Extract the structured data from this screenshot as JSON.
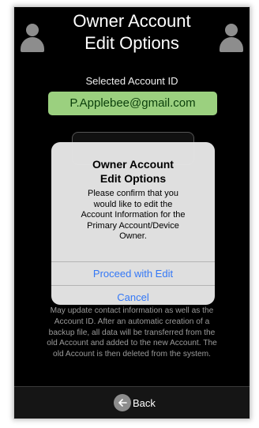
{
  "header": {
    "title_line1": "Owner Account",
    "title_line2": "Edit Options",
    "selected_label": "Selected Account ID",
    "account_id": "P.Applebee@gmail.com"
  },
  "dialog": {
    "title_line1": "Owner Account",
    "title_line2": "Edit Options",
    "message_lines": [
      "Please confirm that you",
      "would like to edit the",
      "Account Information for the",
      "Primary Account/Device",
      "Owner."
    ],
    "proceed_label": "Proceed with Edit",
    "cancel_label": "Cancel"
  },
  "info_lines": [
    "May update contact information as well as the",
    "Account ID. After an automatic creation of a",
    "backup file, all data will be transferred from the",
    "old Account and added to the new Account. The",
    "old Account is then deleted from the system."
  ],
  "footer": {
    "back_label": "Back",
    "back_icon": "arrow-left-icon"
  },
  "icons": {
    "avatar": "user-silhouette-icon"
  },
  "colors": {
    "background": "#000000",
    "account_field": "#9bd07f",
    "account_text": "#0b3f0b",
    "link_blue": "#3478f6",
    "avatar_gray": "#8d8d8d"
  }
}
